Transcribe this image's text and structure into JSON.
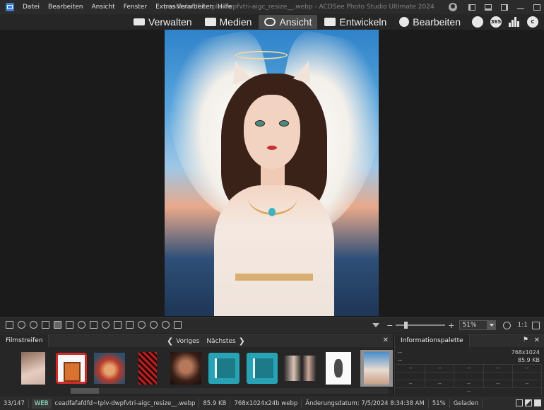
{
  "menu": {
    "items": [
      "Datei",
      "Bearbeiten",
      "Ansicht",
      "Fenster",
      "Extras",
      "Verarbeiten",
      "Hilfe"
    ],
    "window_title": "ceadfafafdfd~tplv-dwpfvtri-aigc_resize__.webp - ACDSee Photo Studio Ultimate 2024"
  },
  "modes": {
    "verwalten": "Verwalten",
    "medien": "Medien",
    "ansicht": "Ansicht",
    "entwickeln": "Entwickeln",
    "bearbeiten": "Bearbeiten",
    "active": "Ansicht"
  },
  "right_icons": {
    "badge_365": "365",
    "badge_c": "C"
  },
  "toolbar": {
    "zoom_value": "51%",
    "zoom_ratio": "1:1",
    "zoom_level": 0.51
  },
  "filmstrip": {
    "title": "Filmstreifen",
    "prev_label": "Voriges",
    "next_label": "Nächstes",
    "thumbnails": [
      "thumb-1",
      "thumb-2",
      "thumb-3",
      "thumb-4",
      "thumb-5",
      "thumb-6",
      "thumb-7",
      "thumb-8",
      "thumb-9",
      "thumb-10"
    ],
    "selected_index": 9
  },
  "info": {
    "title": "Informationspalette",
    "row1_left": "--",
    "row1_right": "768x1024",
    "row2_left": "--",
    "row2_right": "85.9 KB",
    "cell": "--"
  },
  "status": {
    "position": "33/147",
    "format_tag": "WEB",
    "filename": "ceadfafafdfd~tplv-dwpfvtri-aigc_resize__.webp",
    "filesize": "85.9 KB",
    "dimensions": "768x1024x24b webp",
    "modified": "Änderungsdatum: 7/5/2024 8:34:38 AM",
    "zoom": "51%",
    "state": "Geladen"
  },
  "colors": {
    "background": "#1e1e1e",
    "panel": "#262626",
    "active_mode": "#4a4a4a",
    "selected_thumb": "#8f8f8f"
  }
}
